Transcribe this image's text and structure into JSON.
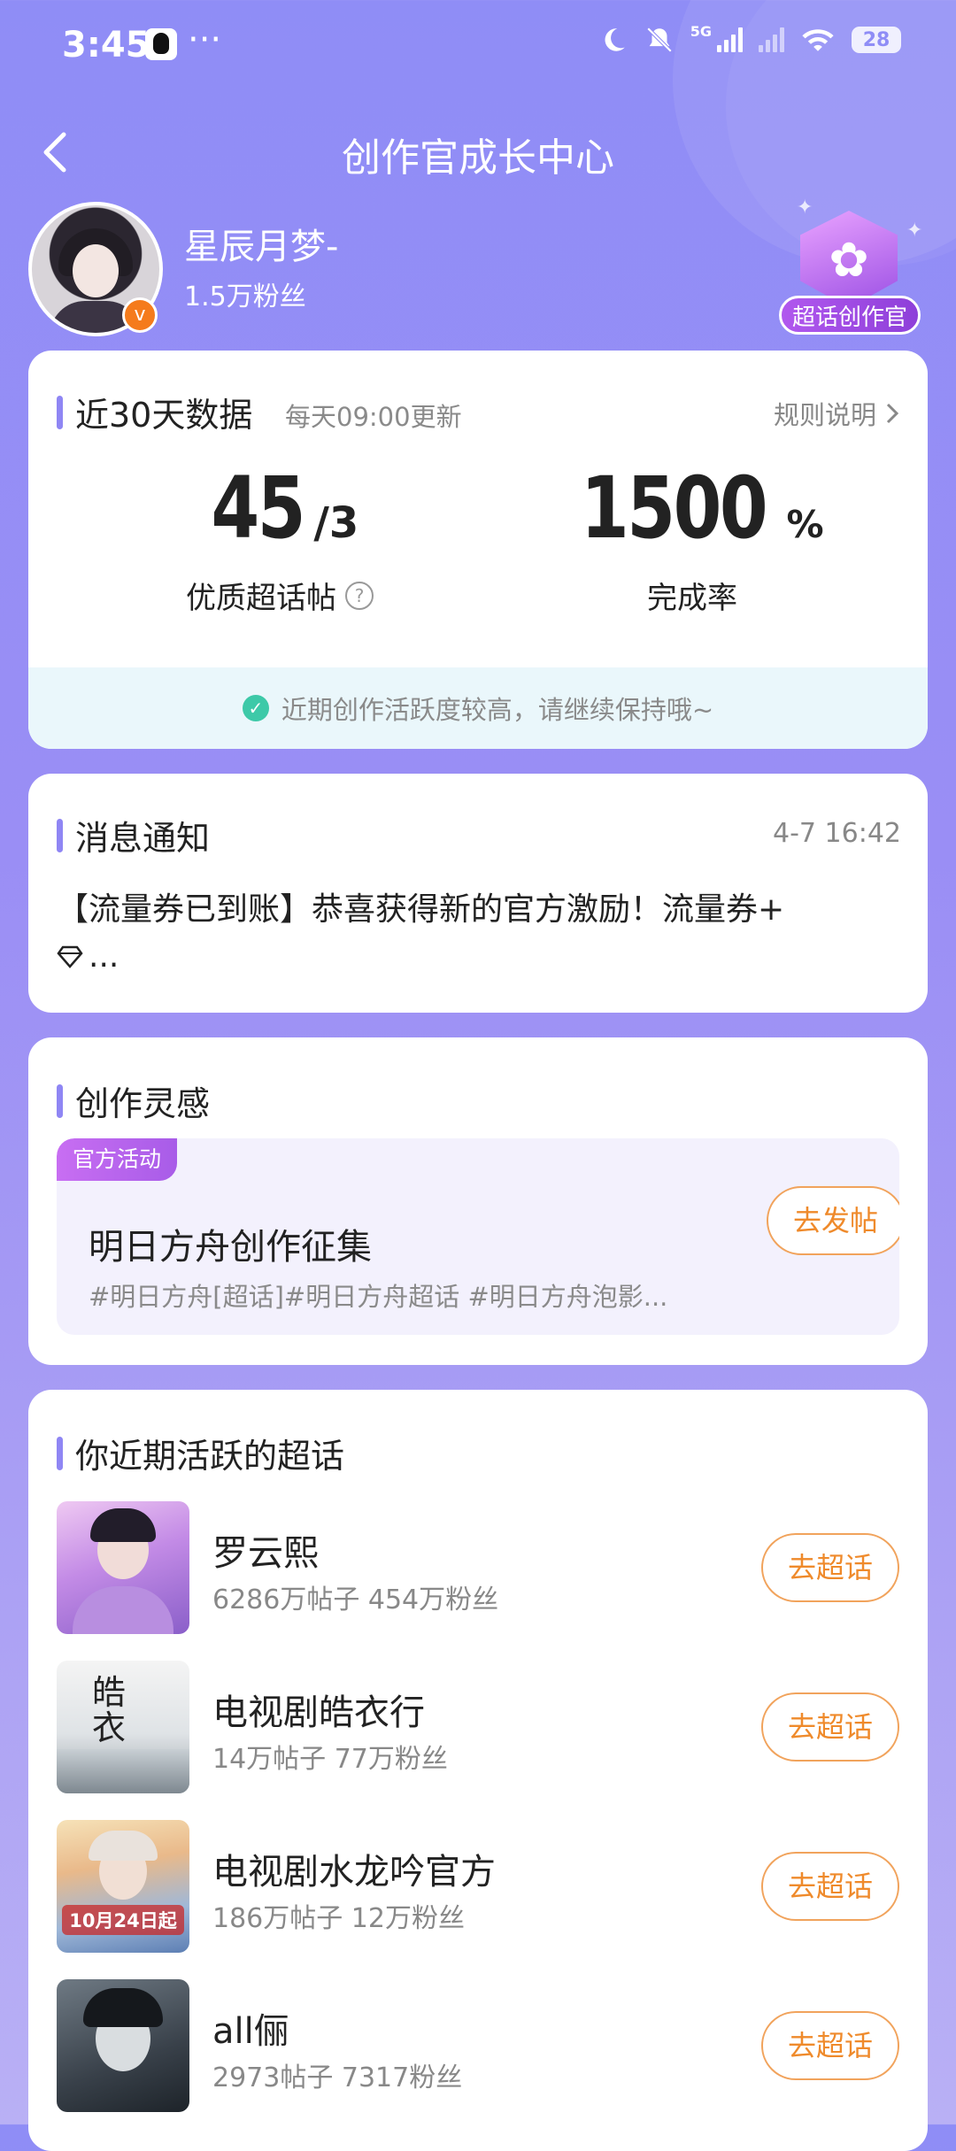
{
  "status_bar": {
    "time": "3:45",
    "more": "···",
    "network": "5G",
    "battery": "28"
  },
  "nav": {
    "title": "创作官成长中心"
  },
  "profile": {
    "name": "星辰月梦-",
    "fans": "1.5万粉丝",
    "badge_label": "超话创作官"
  },
  "stats": {
    "title": "近30天数据",
    "update_note": "每天09:00更新",
    "rules_link": "规则说明",
    "quality_posts": {
      "value": "45",
      "target": "/3",
      "label": "优质超话帖"
    },
    "completion": {
      "value": "1500",
      "unit": "%",
      "label": "完成率"
    },
    "tip": "近期创作活跃度较高，请继续保持哦~"
  },
  "notice": {
    "title": "消息通知",
    "time": "4-7 16:42",
    "text_line1": "【流量券已到账】恭喜获得新的官方激励！流量券+",
    "text_line2": "..."
  },
  "inspiration": {
    "title": "创作灵感",
    "tag": "官方活动",
    "activity_title": "明日方舟创作征集",
    "activity_tags": "#明日方舟[超话]#明日方舟超话 #明日方舟泡影...",
    "post_button": "去发帖"
  },
  "topics": {
    "title": "你近期活跃的超话",
    "items": [
      {
        "name": "罗云熙",
        "meta": "6286万帖子 454万粉丝",
        "button": "去超话"
      },
      {
        "name": "电视剧皓衣行",
        "meta": "14万帖子 77万粉丝",
        "button": "去超话"
      },
      {
        "name": "电视剧水龙吟官方",
        "meta": "186万帖子 12万粉丝",
        "button": "去超话",
        "thumb_text": "10月24日起"
      },
      {
        "name": "all俪",
        "meta": "2973帖子 7317粉丝",
        "button": "去超话"
      }
    ]
  }
}
